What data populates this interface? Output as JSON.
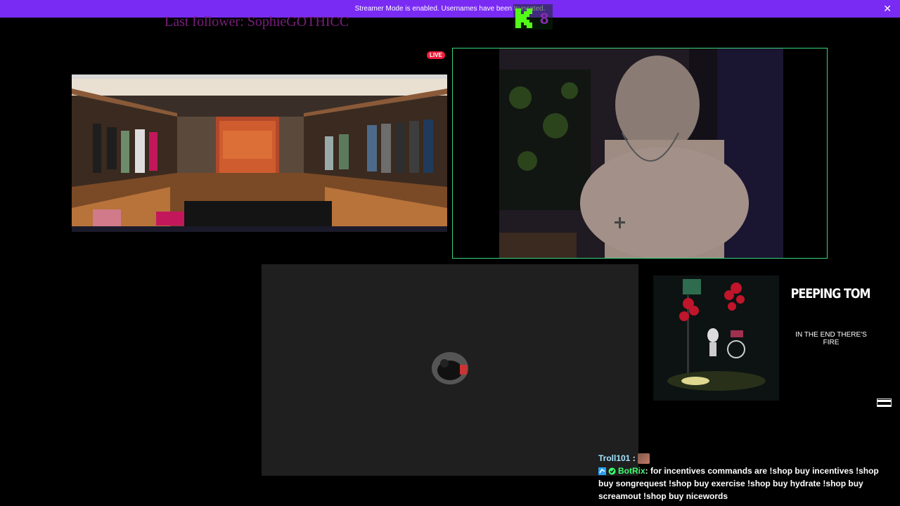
{
  "banner": {
    "text": "Streamer Mode is enabled. Usernames have been truncated.",
    "close_glyph": "✕",
    "color": "#7a2bf3"
  },
  "overlay": {
    "last_follower": "Last follower: SophieGOTHICC",
    "live_badge": "LIVE"
  },
  "now_playing": {
    "title": "PEEPING TOM",
    "lyric": "IN THE END THERE'S FIRE"
  },
  "chat": {
    "messages": [
      {
        "user": "Troll101",
        "separator": " :",
        "text": ""
      },
      {
        "user": "BotRix",
        "separator": ": ",
        "text": "for incentives commands are !shop buy incentives !shop buy songrequest !shop buy exercise !shop buy hydrate !shop buy screamout !shop buy nicewords"
      }
    ]
  },
  "icons": {
    "close": "close-icon",
    "kick_logo": "kick-logo",
    "advisory": "parental-advisory-icon"
  },
  "colors": {
    "accent": "#7a2bf3",
    "live": "#e91e3c",
    "webcam_border": "#3ad67a",
    "follower_text": "#7a1d7d"
  }
}
